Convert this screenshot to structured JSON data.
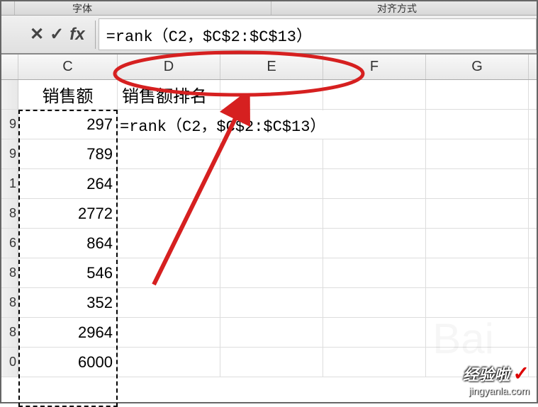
{
  "ribbon": {
    "label_left": "字体",
    "label_right": "对齐方式"
  },
  "formula_bar": {
    "cancel_icon": "✕",
    "confirm_icon": "✓",
    "fx_icon": "fx",
    "formula": "=rank（C2，$C$2:$C$13）"
  },
  "columns": [
    "C",
    "D",
    "E",
    "F",
    "G"
  ],
  "headers": {
    "c": "销售额",
    "d": "销售额排名"
  },
  "row_stubs": [
    "9",
    "9",
    "1",
    "8",
    "6",
    "8",
    "8",
    "8",
    "0"
  ],
  "values_c": [
    "297",
    "789",
    "264",
    "2772",
    "864",
    "546",
    "352",
    "2964",
    "6000"
  ],
  "active_cell_formula": "=rank（C2，$C$2:$C$13）",
  "watermark": {
    "main": "经验啦",
    "check": "✓",
    "sub": "jingyanla.com"
  },
  "annotation_color": "#d62020"
}
